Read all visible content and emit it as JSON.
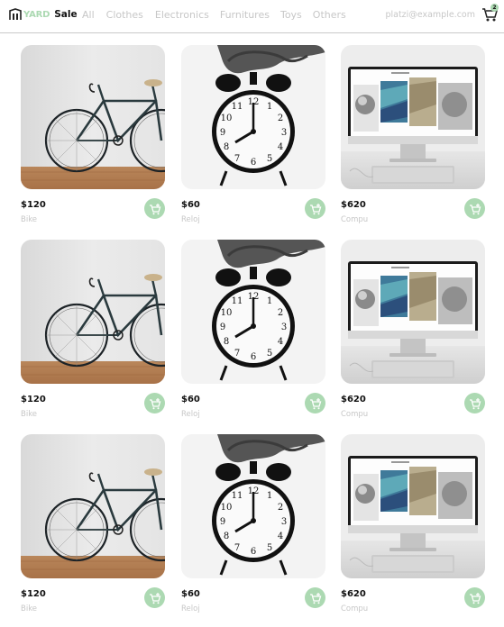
{
  "brand": {
    "accent": "YARD",
    "name": "Sale"
  },
  "nav": {
    "links": [
      "All",
      "Clothes",
      "Electronics",
      "Furnitures",
      "Toys",
      "Others"
    ],
    "email": "platzi@example.com",
    "cart_count": "2"
  },
  "products": [
    {
      "price": "$120",
      "name": "Bike",
      "image": "bike"
    },
    {
      "price": "$60",
      "name": "Reloj",
      "image": "clock"
    },
    {
      "price": "$620",
      "name": "Compu",
      "image": "computer"
    },
    {
      "price": "$120",
      "name": "Bike",
      "image": "bike"
    },
    {
      "price": "$60",
      "name": "Reloj",
      "image": "clock"
    },
    {
      "price": "$620",
      "name": "Compu",
      "image": "computer"
    },
    {
      "price": "$120",
      "name": "Bike",
      "image": "bike"
    },
    {
      "price": "$60",
      "name": "Reloj",
      "image": "clock"
    },
    {
      "price": "$620",
      "name": "Compu",
      "image": "computer"
    }
  ],
  "colors": {
    "accent": "#acd9b2",
    "muted_text": "#c7c7c7",
    "text": "#111111",
    "border": "#c9c9c9"
  }
}
